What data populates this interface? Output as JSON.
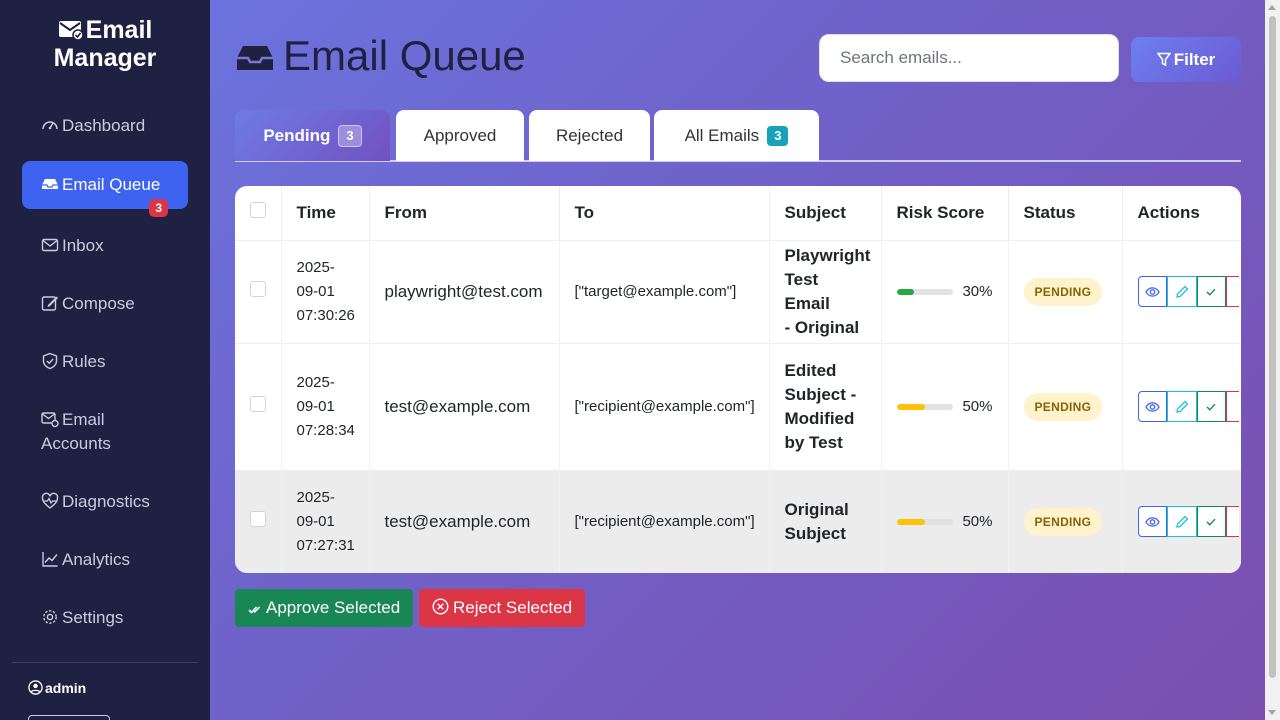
{
  "brand": {
    "line1": "Email",
    "line2": "Manager"
  },
  "sidebar": {
    "items": [
      {
        "label": "Dashboard",
        "icon": "speedometer-icon"
      },
      {
        "label": "Email Queue",
        "icon": "inbox-tray-icon",
        "badge": "3"
      },
      {
        "label": "Inbox",
        "icon": "envelope-icon"
      },
      {
        "label": "Compose",
        "icon": "pencil-square-icon"
      },
      {
        "label": "Rules",
        "icon": "shield-check-icon"
      },
      {
        "label": "Email",
        "label2": "Accounts",
        "icon": "envelope-gear-icon"
      },
      {
        "label": "Diagnostics",
        "icon": "heart-pulse-icon"
      },
      {
        "label": "Analytics",
        "icon": "graph-up-icon"
      },
      {
        "label": "Settings",
        "icon": "gear-icon"
      }
    ],
    "user": "admin"
  },
  "header": {
    "title": "Email Queue",
    "search_placeholder": "Search emails...",
    "filter_label": "Filter"
  },
  "tabs": [
    {
      "label": "Pending",
      "count": "3"
    },
    {
      "label": "Approved"
    },
    {
      "label": "Rejected"
    },
    {
      "label": "All Emails",
      "count": "3"
    }
  ],
  "table": {
    "columns": [
      "Time",
      "From",
      "To",
      "Subject",
      "Risk Score",
      "Status",
      "Actions"
    ],
    "rows": [
      {
        "time": [
          "2025-",
          "09-01",
          "07:30:26"
        ],
        "from": "playwright@test.com",
        "to": "[\"target@example.com\"]",
        "subject": [
          "Playwright",
          "Test Email",
          "- Original"
        ],
        "risk": "30%",
        "risk_value": 0.3,
        "risk_color": "#28a745",
        "status": "PENDING"
      },
      {
        "time": [
          "2025-",
          "09-01",
          "07:28:34"
        ],
        "from": "test@example.com",
        "to": "[\"recipient@example.com\"]",
        "subject": [
          "Edited",
          "Subject -",
          "Modified",
          "by Test"
        ],
        "risk": "50%",
        "risk_value": 0.5,
        "risk_color": "#ffc107",
        "status": "PENDING"
      },
      {
        "time": [
          "2025-",
          "09-01",
          "07:27:31"
        ],
        "from": "test@example.com",
        "to": "[\"recipient@example.com\"]",
        "subject": [
          "Original",
          "Subject"
        ],
        "risk": "50%",
        "risk_value": 0.5,
        "risk_color": "#ffc107",
        "status": "PENDING"
      }
    ]
  },
  "bulk": {
    "approve_label": "Approve Selected",
    "reject_label": "Reject Selected"
  },
  "colors": {
    "sidebar_bg": "#1e2142",
    "active_nav": "#3d63f0",
    "success": "#198754",
    "danger": "#dc3545",
    "info": "#17a2b8"
  }
}
